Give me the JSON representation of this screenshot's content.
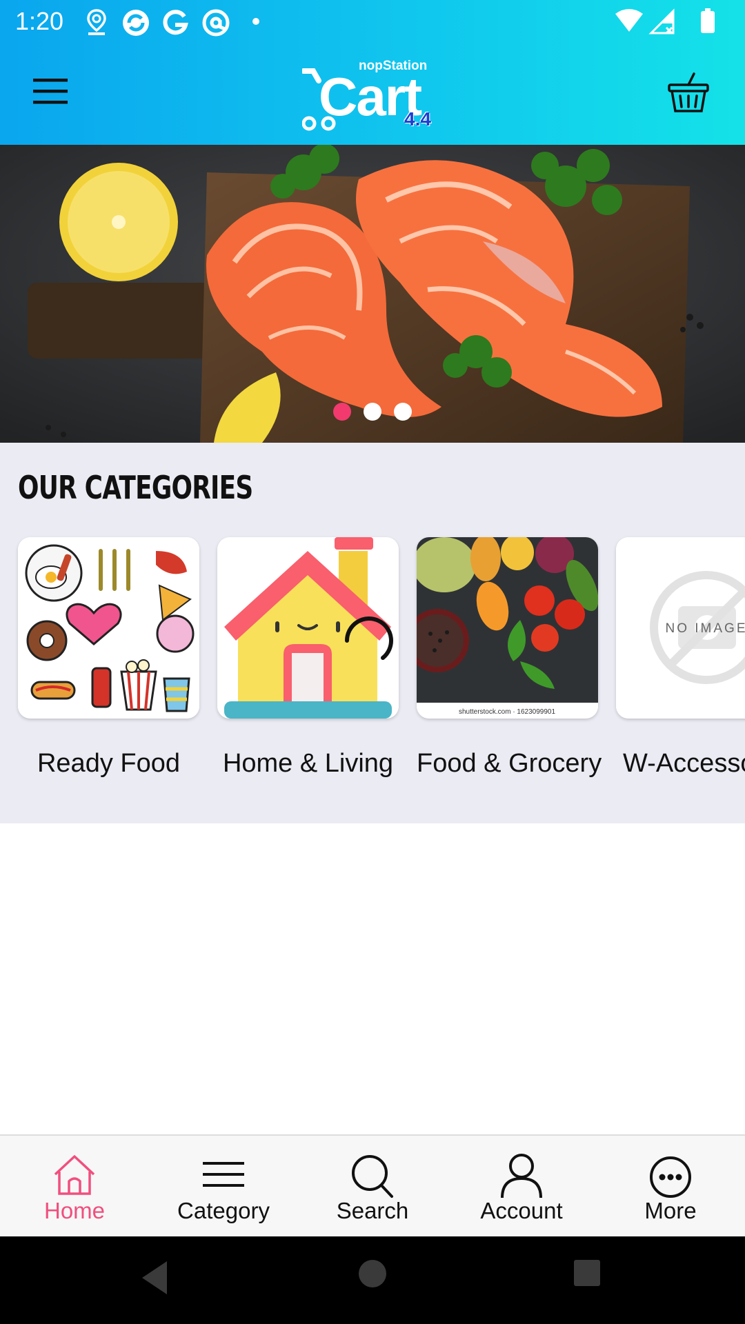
{
  "status_bar": {
    "time": "1:20"
  },
  "header": {
    "logo_brand": "nopStation",
    "logo_word": "Cart",
    "logo_version": "4.4"
  },
  "banner": {
    "slide_count": 3,
    "active_slide": 1
  },
  "categories": {
    "title": "OUR CATEGORIES",
    "items": [
      {
        "label": "Ready Food"
      },
      {
        "label": "Home &  Living"
      },
      {
        "label": "Food & Grocery",
        "image_caption": "shutterstock.com · 1623099901"
      },
      {
        "label": "W-Accesso",
        "placeholder_text": "NO IMAGE"
      }
    ]
  },
  "bottom_nav": {
    "items": [
      {
        "label": "Home",
        "icon": "home-icon",
        "active": true
      },
      {
        "label": "Category",
        "icon": "menu-lines-icon"
      },
      {
        "label": "Search",
        "icon": "search-icon"
      },
      {
        "label": "Account",
        "icon": "person-icon"
      },
      {
        "label": "More",
        "icon": "more-dots-icon"
      }
    ]
  },
  "colors": {
    "header_start": "#0aa6ee",
    "header_end": "#14e2e8",
    "accent": "#f04f7e",
    "category_bg": "#ebebf3"
  }
}
